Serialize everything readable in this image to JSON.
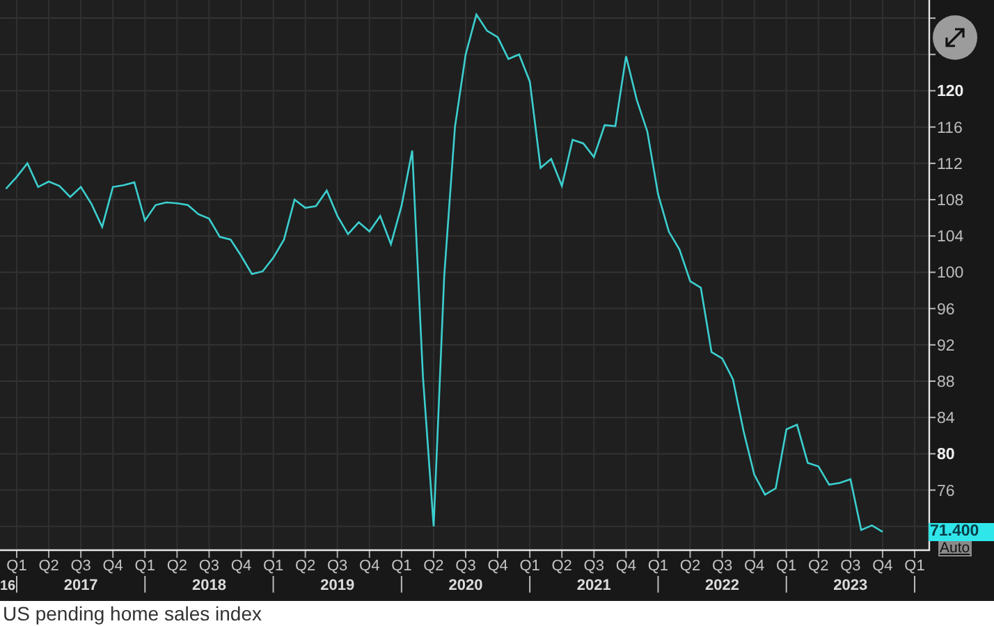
{
  "chart": {
    "chart_data": {
      "type": "line",
      "grid": true,
      "ylim": [
        69.3,
        130
      ],
      "categories": [
        null,
        "Q1",
        null,
        null,
        "Q2",
        null,
        null,
        "Q3",
        null,
        null,
        "Q4",
        null,
        null,
        "Q1",
        null,
        null,
        "Q2",
        null,
        null,
        "Q3",
        null,
        null,
        "Q4",
        null,
        null,
        "Q1",
        null,
        null,
        "Q2",
        null,
        null,
        "Q3",
        null,
        null,
        "Q4",
        null,
        null,
        "Q1",
        null,
        null,
        "Q2",
        null,
        null,
        "Q3",
        null,
        null,
        "Q4",
        null,
        null,
        "Q1",
        null,
        null,
        "Q2",
        null,
        null,
        "Q3",
        null,
        null,
        "Q4",
        null,
        null,
        "Q1",
        null,
        null,
        "Q2",
        null,
        null,
        "Q3",
        null,
        null,
        "Q4",
        null,
        null,
        "Q1",
        null,
        null,
        "Q2",
        null,
        null,
        "Q3",
        null,
        null,
        "Q4",
        null,
        null,
        "Q1"
      ],
      "series": [
        {
          "color": "#3ccfcf",
          "values": [
            109.2,
            110.5,
            112,
            109.4,
            110,
            109.5,
            108.3,
            109.4,
            107.5,
            105,
            109.4,
            109.6,
            109.9,
            105.7,
            107.4,
            107.7,
            107.6,
            107.4,
            106.4,
            105.9,
            103.9,
            103.6,
            101.8,
            99.8,
            100.1,
            101.6,
            103.6,
            108,
            107.1,
            107.3,
            109,
            106.2,
            104.2,
            105.5,
            104.5,
            106.2,
            103.1,
            107.3,
            113.4,
            88.5,
            72,
            99.6,
            116,
            124,
            128.4,
            126.6,
            125.9,
            123.5,
            124,
            121,
            111.5,
            112.5,
            109.5,
            114.6,
            114.2,
            112.7,
            116.2,
            116.1,
            123.8,
            119,
            115.5,
            108.6,
            104.5,
            102.5,
            99,
            98.3,
            91.2,
            90.5,
            88.2,
            82.5,
            77.7,
            75.5,
            76.2,
            82.7,
            83.2,
            79,
            78.6,
            76.6,
            76.8,
            77.2,
            71.6,
            72.1,
            71.4,
            null,
            null,
            null
          ]
        }
      ],
      "yticks": [
        76,
        80,
        84,
        88,
        92,
        96,
        100,
        104,
        108,
        112,
        116,
        120
      ]
    },
    "year_labels": [
      "16",
      "2017",
      "2018",
      "2019",
      "2020",
      "2021",
      "2022",
      "2023"
    ],
    "last_value": "71.400",
    "scale_mode": "Auto"
  },
  "caption": "US pending home sales index"
}
